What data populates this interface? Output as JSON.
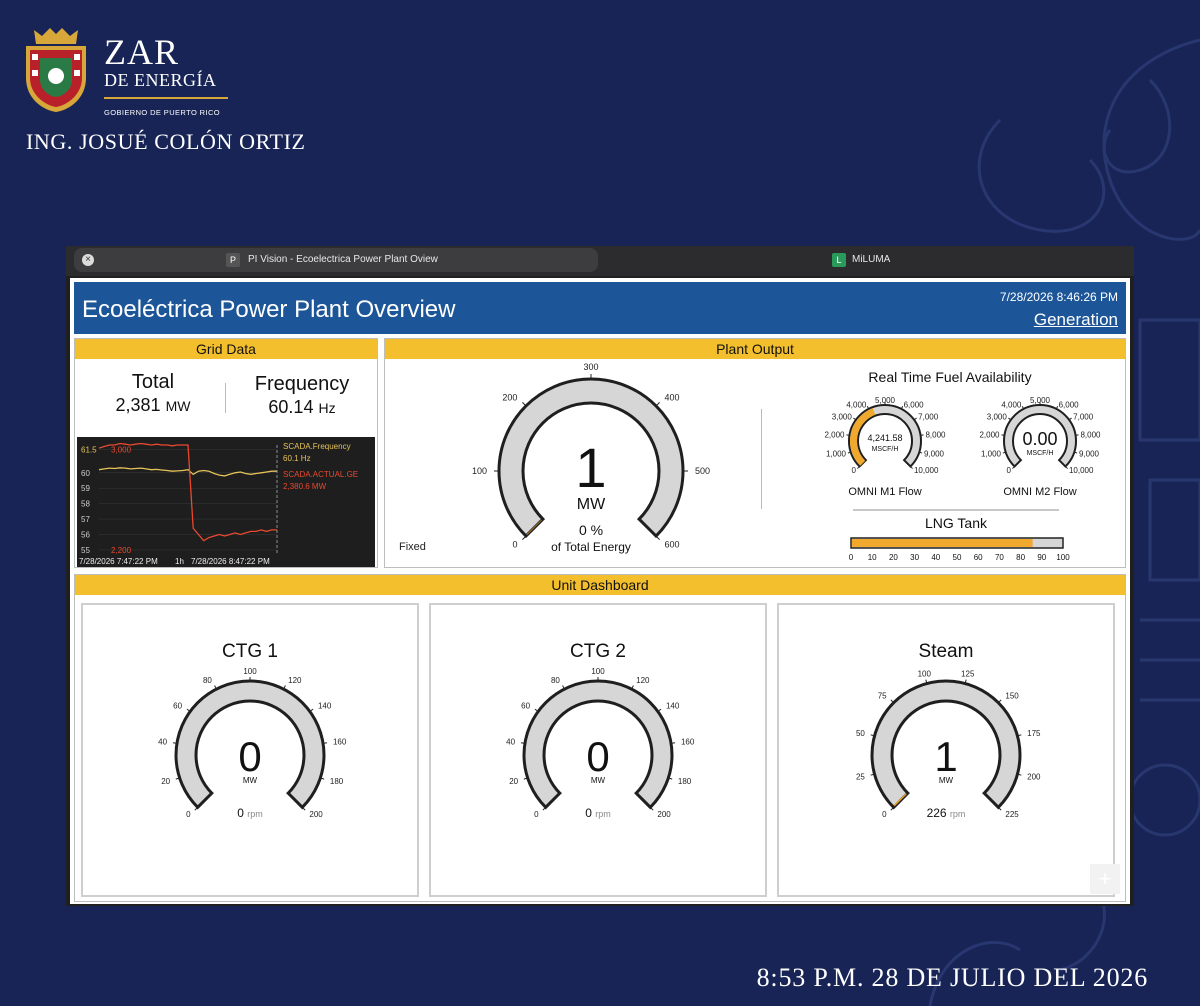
{
  "branding": {
    "title_line1": "ZAR",
    "title_line2": "DE ENERGÍA",
    "government": "GOBIERNO DE PUERTO RICO",
    "person": "ING. JOSUÉ COLÓN ORTIZ",
    "footer_timestamp": "8:53 P.M. 28 DE JULIO DEL 2026",
    "accent_color": "#d7a73a",
    "background_color": "#172455"
  },
  "browser": {
    "tabs": [
      {
        "label": "PI Vision - Ecoelectrica Power Plant Oview",
        "favicon": "P",
        "active": true
      },
      {
        "label": "MiLUMA",
        "favicon": "L",
        "active": false
      }
    ],
    "close_icon": "close-icon"
  },
  "dashboard": {
    "title": "Ecoeléctrica Power Plant Overview",
    "timestamp": "7/28/2026 8:46:26 PM",
    "link": "Generation",
    "header_color": "#1d5698",
    "panel_color": "#f4bf2c"
  },
  "grid_data": {
    "header": "Grid Data",
    "total_label": "Total",
    "total_value": "2,381",
    "total_unit": "MW",
    "frequency_label": "Frequency",
    "frequency_value": "60.14",
    "frequency_unit": "Hz",
    "trend": {
      "y_ticks": [
        "61.5",
        "60",
        "59",
        "58",
        "57",
        "56",
        "55"
      ],
      "y_ticks_right": [
        "3,000",
        "2,200"
      ],
      "start_time": "7/28/2026 7:47:22 PM",
      "span": "1h",
      "end_time": "7/28/2026 8:47:22 PM",
      "legend": [
        {
          "name": "SCADA.Frequency",
          "value": "60.1 Hz",
          "color": "#e6c25a"
        },
        {
          "name": "SCADA.ACTUAL.GE",
          "value": "2,380.6 MW",
          "color": "#e8492f"
        }
      ],
      "frequency_series": [
        60.2,
        60.25,
        60.3,
        60.28,
        60.32,
        60.3,
        60.25,
        60.28,
        60.3,
        60.25,
        60.2,
        60.22,
        60.18,
        60.15,
        60.1,
        60.12,
        60.15,
        60.2,
        59.9,
        60.1,
        60.15,
        60.1,
        59.95,
        59.85,
        59.8,
        59.9,
        60.0,
        60.05,
        59.95,
        59.9,
        59.95,
        60.0,
        60.05,
        60.1,
        60.1
      ],
      "generation_series": [
        61.6,
        61.7,
        61.8,
        61.8,
        61.9,
        61.85,
        61.8,
        61.85,
        61.9,
        61.85,
        61.8,
        61.85,
        61.8,
        61.8,
        61.75,
        61.8,
        61.8,
        61.8,
        56.4,
        56.0,
        55.6,
        55.8,
        55.9,
        56.0,
        55.9,
        56.0,
        56.1,
        56.0,
        56.1,
        56.2,
        56.2,
        56.3,
        56.2,
        56.3,
        56.3
      ]
    }
  },
  "plant_output": {
    "header": "Plant Output",
    "value": "1",
    "value_num": 1,
    "unit": "MW",
    "percent": "0 %",
    "percent_label": "of Total Energy",
    "mode": "Fixed",
    "scale": [
      0,
      100,
      200,
      300,
      400,
      500,
      600
    ],
    "fuel_title": "Real Time Fuel Availability",
    "fuel_gauges": [
      {
        "label": "OMNI M1 Flow",
        "value": "4,241.58",
        "value_num": 4241.58,
        "unit": "MSCF/H",
        "scale": [
          "0",
          "1,000",
          "2,000",
          "3,000",
          "4,000",
          "5,000",
          "6,000",
          "7,000",
          "8,000",
          "9,000",
          "10,000"
        ]
      },
      {
        "label": "OMNI M2 Flow",
        "value": "0.00",
        "value_num": 0,
        "unit": "MSCF/H",
        "scale": [
          "0",
          "1,000",
          "2,000",
          "3,000",
          "4,000",
          "5,000",
          "6,000",
          "7,000",
          "8,000",
          "9,000",
          "10,000"
        ]
      }
    ],
    "lng_title": "LNG Tank",
    "lng_level": 86,
    "lng_scale": [
      "0",
      "10",
      "20",
      "30",
      "40",
      "50",
      "60",
      "70",
      "80",
      "90",
      "100"
    ]
  },
  "units": {
    "header": "Unit Dashboard",
    "cards": [
      {
        "name": "CTG 1",
        "value": "0",
        "value_num": 0,
        "unit": "MW",
        "rpm": "0",
        "rpm_unit": "rpm",
        "max": 200,
        "scale": [
          "0",
          "20",
          "40",
          "60",
          "80",
          "100",
          "120",
          "140",
          "160",
          "180",
          "200"
        ]
      },
      {
        "name": "CTG 2",
        "value": "0",
        "value_num": 0,
        "unit": "MW",
        "rpm": "0",
        "rpm_unit": "rpm",
        "max": 200,
        "scale": [
          "0",
          "20",
          "40",
          "60",
          "80",
          "100",
          "120",
          "140",
          "160",
          "180",
          "200"
        ]
      },
      {
        "name": "Steam",
        "value": "1",
        "value_num": 1,
        "unit": "MW",
        "rpm": "226",
        "rpm_unit": "rpm",
        "max": 225,
        "scale": [
          "0",
          "25",
          "50",
          "75",
          "100",
          "125",
          "150",
          "175",
          "200",
          "225"
        ]
      }
    ],
    "plus": "+"
  }
}
